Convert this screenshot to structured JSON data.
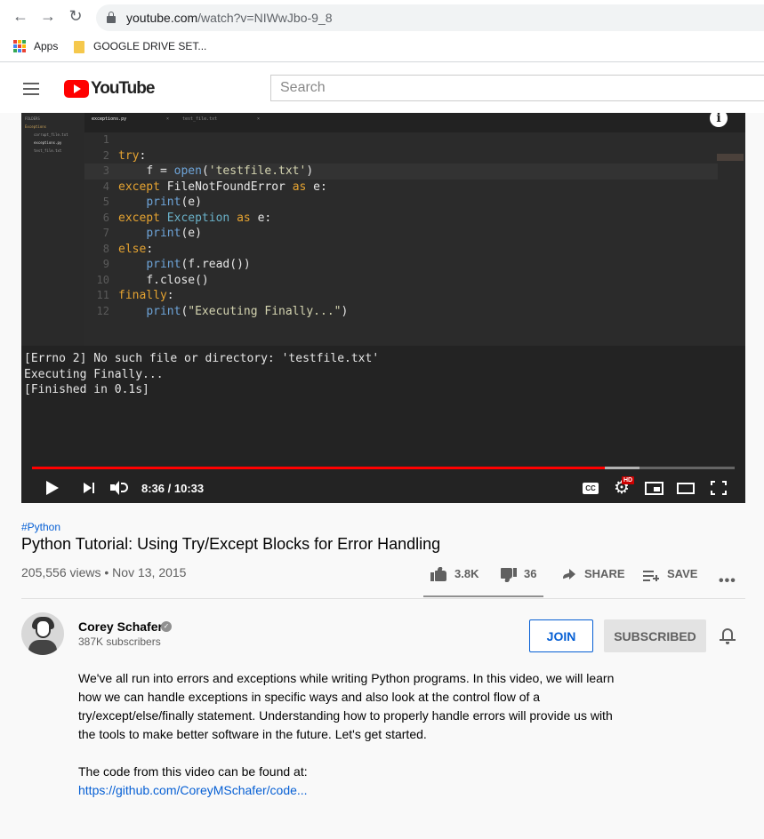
{
  "browser": {
    "url_host": "youtube.com",
    "url_path": "/watch?v=NIWwJbo-9_8",
    "bookmarks": [
      {
        "label": "Apps"
      },
      {
        "label": "GOOGLE DRIVE SET..."
      }
    ]
  },
  "header": {
    "logo_text": "YouTube",
    "search_placeholder": "Search"
  },
  "player": {
    "editor_tabs": [
      "exceptions.py",
      "test_file.txt"
    ],
    "sidebar_items": [
      "FOLDERS",
      "Exceptions",
      "corrupt_file.txt",
      "exceptions.py",
      "test_file.txt"
    ],
    "code_lines": [
      {
        "n": "1",
        "text": ""
      },
      {
        "n": "2",
        "text": "try:"
      },
      {
        "n": "3",
        "text": "    f = open('testfile.txt')"
      },
      {
        "n": "4",
        "text": "except FileNotFoundError as e:"
      },
      {
        "n": "5",
        "text": "    print(e)"
      },
      {
        "n": "6",
        "text": "except Exception as e:"
      },
      {
        "n": "7",
        "text": "    print(e)"
      },
      {
        "n": "8",
        "text": "else:"
      },
      {
        "n": "9",
        "text": "    print(f.read())"
      },
      {
        "n": "10",
        "text": "    f.close()"
      },
      {
        "n": "11",
        "text": "finally:"
      },
      {
        "n": "12",
        "text": "    print(\"Executing Finally...\")"
      }
    ],
    "console_lines": [
      "[Errno 2] No such file or directory: 'testfile.txt'",
      "Executing Finally...",
      "[Finished in 0.1s]"
    ],
    "current_time": "8:36",
    "duration": "10:33",
    "time_display": "8:36 / 10:33",
    "played_fraction": 0.815,
    "buffered_fraction": 0.865,
    "cc_label": "CC",
    "hd_label": "HD"
  },
  "video": {
    "hashtag": "#Python",
    "title": "Python Tutorial: Using Try/Except Blocks for Error Handling",
    "views_date": "205,556 views • Nov 13, 2015",
    "likes": "3.8K",
    "dislikes": "36",
    "share_label": "SHARE",
    "save_label": "SAVE"
  },
  "channel": {
    "name": "Corey Schafer",
    "subscribers": "387K subscribers",
    "join_label": "JOIN",
    "subscribed_label": "SUBSCRIBED"
  },
  "description": {
    "paragraph1": "We've all run into errors and exceptions while writing Python programs. In this video, we will learn how we can handle exceptions in specific ways and also look at the control flow of a try/except/else/finally statement. Understanding how to properly handle errors will provide us with the tools to make better software in the future. Let's get started.",
    "paragraph2": "The code from this video can be found at:",
    "link": "https://github.com/CoreyMSchafer/code..."
  },
  "colors": {
    "accent_red": "#ff0000",
    "link_blue": "#065fd4",
    "keyword_orange": "#e5a331",
    "function_blue": "#6ea4d8"
  }
}
